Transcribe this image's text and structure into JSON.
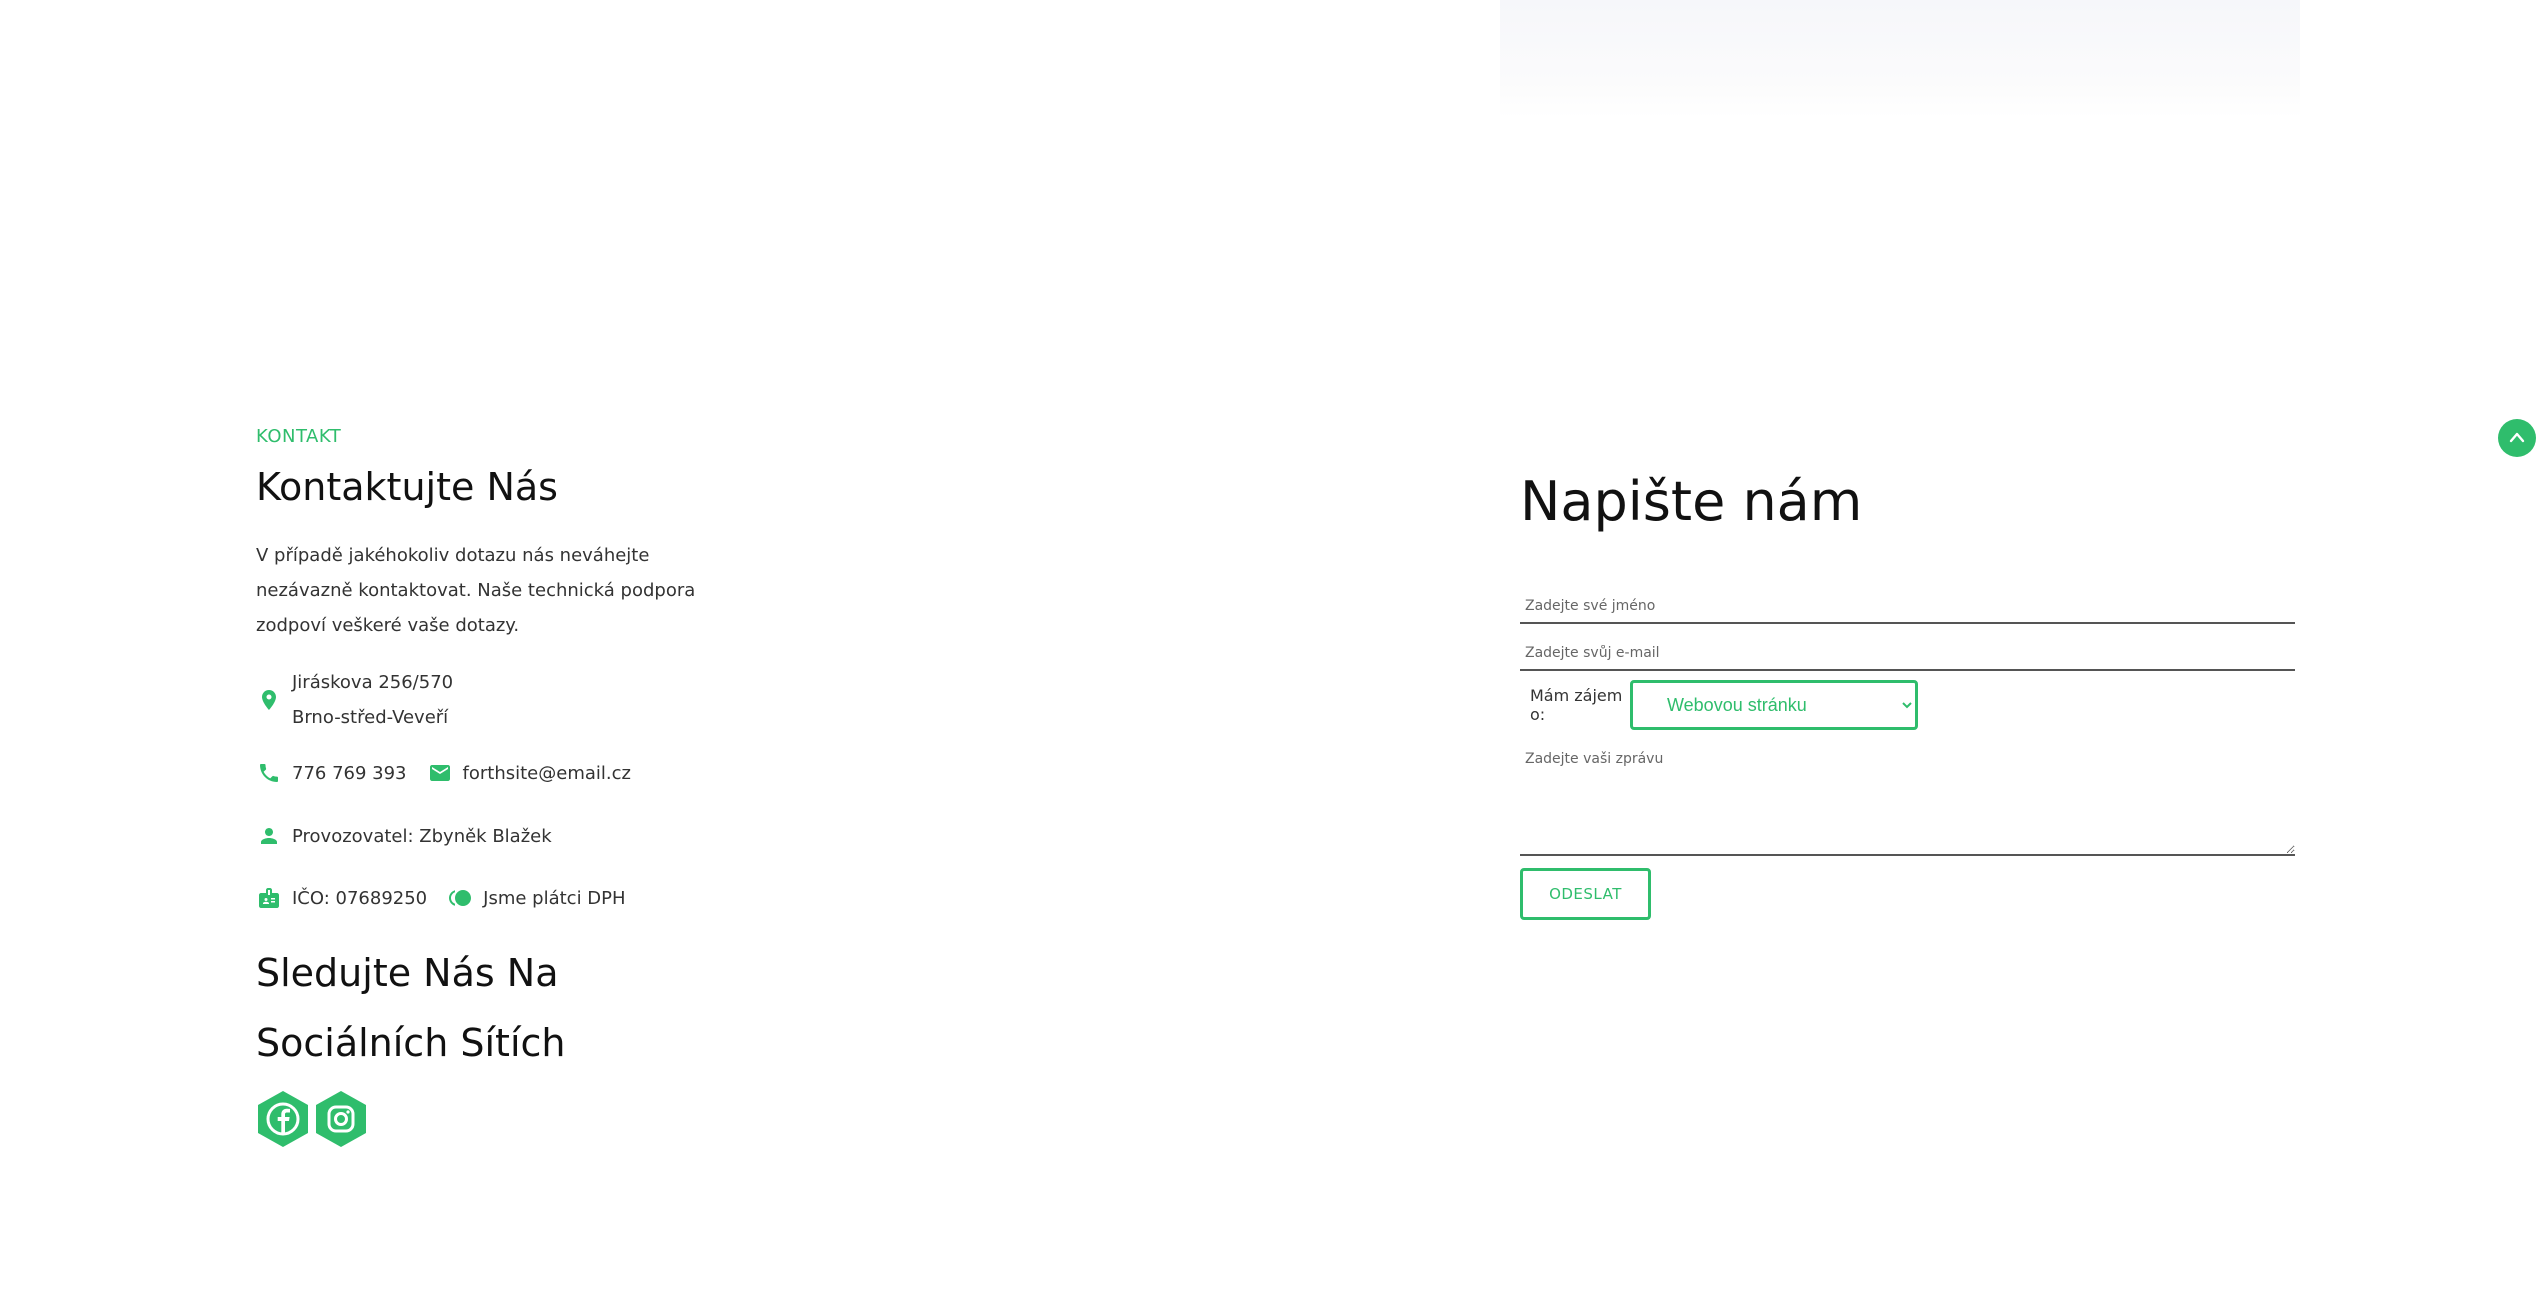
{
  "contact": {
    "eyebrow": "KONTAKT",
    "title": "Kontaktujte Nás",
    "intro": "V případě jakéhokoliv dotazu nás neváhejte nezávazně kontaktovat. Naše technická podpora zodpoví veškeré vaše dotazy.",
    "address_line1": "Jiráskova 256/570",
    "address_line2": "Brno-střed-Veveří",
    "phone": "776 769 393",
    "email": "forthsite@email.cz",
    "operator": "Provozovatel: Zbyněk Blažek",
    "ico": "IČO: 07689250",
    "vat": "Jsme plátci DPH",
    "social_title": "Sledujte Nás Na Sociálních Sítích",
    "socials": [
      "facebook-icon",
      "instagram-icon"
    ]
  },
  "form": {
    "title": "Napište nám",
    "name_placeholder": "Zadejte své jméno",
    "email_placeholder": "Zadejte svůj e-mail",
    "interest_label": "Mám zájem o:",
    "interest_value": "Webovou stránku",
    "message_placeholder": "Zadejte vaši zprávu",
    "submit_label": "ODESLAT"
  },
  "colors": {
    "accent": "#2fbd6c",
    "text": "#1a1a1a",
    "muted": "#333333"
  },
  "icons": {
    "location": "location-pin-icon",
    "phone": "phone-icon",
    "email": "envelope-icon",
    "person": "person-icon",
    "id": "id-card-icon",
    "vat": "coins-icon",
    "scroll_top": "chevron-up-icon"
  }
}
